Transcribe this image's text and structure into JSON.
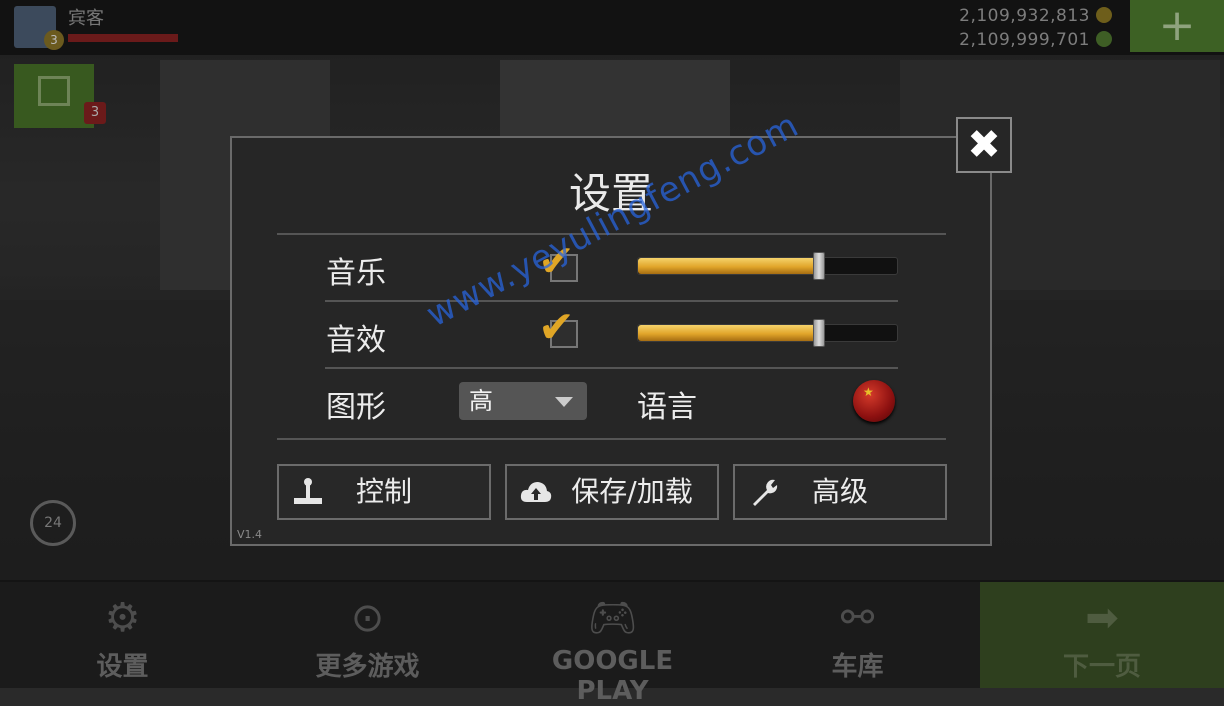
{
  "topbar": {
    "username": "宾客",
    "level": "3",
    "money_1": "2,109,932,813",
    "money_2": "2,109,999,701",
    "add_label": "+"
  },
  "sidebar": {
    "gift_count": "3",
    "timer_label": "24"
  },
  "dialog": {
    "title": "设置",
    "close_label": "✖",
    "music_label": "音乐",
    "music_enabled": true,
    "music_volume": 0.7,
    "sfx_label": "音效",
    "sfx_enabled": true,
    "sfx_volume": 0.7,
    "graphics_label": "图形",
    "graphics_value": "高",
    "language_label": "语言",
    "language_flag": "china-flag",
    "buttons": {
      "controls": "控制",
      "save_load": "保存/加载",
      "advanced": "高级"
    },
    "version": "V1.4"
  },
  "watermark": "www.yeyulingfeng.com",
  "bottom_nav": {
    "settings": "设置",
    "more_games": "更多游戏",
    "google_play": "GOOGLE PLAY",
    "garage": "车库",
    "next": "下一页"
  },
  "colors": {
    "accent_gold": "#e0a626",
    "dialog_bg": "#262626",
    "border": "#6a6a6a"
  }
}
